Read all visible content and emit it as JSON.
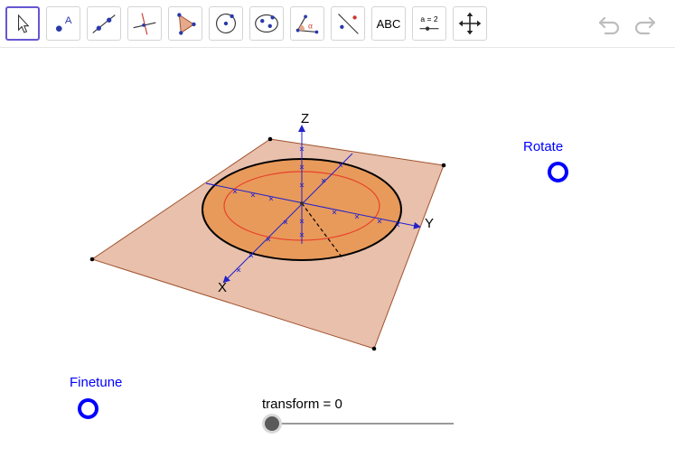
{
  "toolbar": {
    "tools": [
      {
        "name": "move",
        "icon": "cursor-arrow-icon"
      },
      {
        "name": "point",
        "icon": "point-icon",
        "letter": "A"
      },
      {
        "name": "line",
        "icon": "line-icon"
      },
      {
        "name": "perpendicular-line",
        "icon": "perpendicular-line-icon"
      },
      {
        "name": "polygon",
        "icon": "polygon-icon"
      },
      {
        "name": "circle-center-point",
        "icon": "circle-icon"
      },
      {
        "name": "ellipse",
        "icon": "ellipse-icon"
      },
      {
        "name": "angle",
        "icon": "angle-icon",
        "letter": "α"
      },
      {
        "name": "reflect",
        "icon": "reflect-icon"
      },
      {
        "name": "text",
        "icon": "text-icon",
        "label": "ABC"
      },
      {
        "name": "slider",
        "icon": "slider-icon",
        "label": "a = 2"
      },
      {
        "name": "move-graphics",
        "icon": "move-graphics-icon"
      }
    ],
    "undo_icon": "undo-icon",
    "redo_icon": "redo-icon"
  },
  "view": {
    "axes": {
      "x": "X",
      "y": "Y",
      "z": "Z"
    },
    "colors": {
      "plane": "#e8c0ac",
      "disk": "#e89a5a",
      "inner_circle": "#e8412a",
      "axis": "#2222cc"
    }
  },
  "checkboxes": {
    "rotate": {
      "label": "Rotate"
    },
    "finetune": {
      "label": "Finetune"
    }
  },
  "slider": {
    "label": "transform = 0",
    "value": 0
  }
}
